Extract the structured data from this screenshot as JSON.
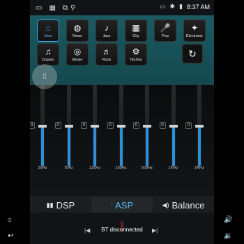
{
  "status": {
    "time": "8:37 AM"
  },
  "presets": {
    "row1": [
      {
        "label": "User",
        "icon": "user-icon",
        "glyph": "⌂",
        "active": true
      },
      {
        "label": "News",
        "icon": "globe-icon",
        "glyph": "◍",
        "active": false
      },
      {
        "label": "Jazz",
        "icon": "saxophone-icon",
        "glyph": "♪",
        "active": false
      },
      {
        "label": "City",
        "icon": "city-icon",
        "glyph": "▦",
        "active": false
      },
      {
        "label": "Pop",
        "icon": "microphone-icon",
        "glyph": "🎤",
        "active": false
      },
      {
        "label": "Electronic",
        "icon": "electronic-icon",
        "glyph": "✦",
        "active": false
      }
    ],
    "row2": [
      {
        "label": "Classic",
        "icon": "gramophone-icon",
        "glyph": "♫",
        "active": false
      },
      {
        "label": "Movie",
        "icon": "film-reel-icon",
        "glyph": "◎",
        "active": false
      },
      {
        "label": "Rock",
        "icon": "guitar-icon",
        "glyph": "♬",
        "active": false
      },
      {
        "label": "Techno",
        "icon": "gear-icon",
        "glyph": "⚙",
        "active": false
      }
    ]
  },
  "eq": {
    "bands": [
      {
        "freq": "30Hz",
        "zero": "0",
        "level": 0.5
      },
      {
        "freq": "75Hz",
        "zero": "0",
        "level": 0.5
      },
      {
        "freq": "125Hz",
        "zero": "0",
        "level": 0.5
      },
      {
        "freq": "250Hz",
        "zero": "0",
        "level": 0.5
      },
      {
        "freq": "500Hz",
        "zero": "0",
        "level": 0.5
      },
      {
        "freq": "1KHz",
        "zero": "0",
        "level": 0.5
      },
      {
        "freq": "2KHz",
        "zero": "0",
        "level": 0.5
      }
    ]
  },
  "tabs": {
    "dsp": "DSP",
    "asp": "ASP",
    "balance": "Balance"
  },
  "bt": {
    "status": "BT disconnected"
  },
  "colors": {
    "accent": "#2d8fd9",
    "header": "#1b5a61",
    "bt_icon": "#e03030"
  }
}
